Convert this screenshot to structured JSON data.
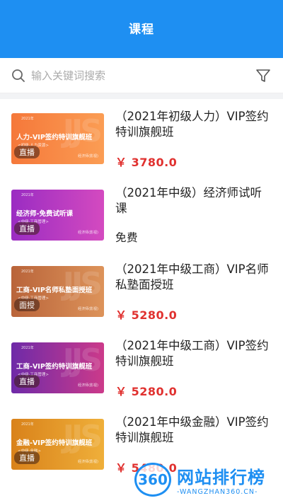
{
  "header": {
    "title": "课程"
  },
  "search": {
    "placeholder": "输入关键词搜索",
    "icon": "search-icon",
    "filter_icon": "filter-icon"
  },
  "courses": [
    {
      "title": "（2021年初级人力）VIP签约特训旗舰班",
      "price": "￥ 3780.0",
      "thumb": {
        "year": "2021年",
        "name": "人力-VIP签约特训旗舰班",
        "sub": "<初级·人力资源>",
        "tag": "直播",
        "brand": "经济师(影视)",
        "jjs": "JJS"
      }
    },
    {
      "title": "（2021年中级）经济师试听课",
      "price": "免费",
      "thumb": {
        "year": "2021年",
        "name": "经济师-免费试听课",
        "sub": "<中级·工商管理>",
        "tag": "直播",
        "brand": "经济师(影视)",
        "jjs": ""
      }
    },
    {
      "title": "（2021年中级工商）VIP名师私塾面授班",
      "price": "￥ 5280.0",
      "thumb": {
        "year": "2021年",
        "name": "工商-VIP名师私塾面授班",
        "sub": "<中级·工商管理>",
        "tag": "面授",
        "brand": "经济师(影视)",
        "jjs": "JJS"
      }
    },
    {
      "title": "（2021年中级工商）VIP签约特训旗舰班",
      "price": "￥ 5280.0",
      "thumb": {
        "year": "2021年",
        "name": "工商-VIP签约特训旗舰班",
        "sub": "<中级·工商管理>",
        "tag": "直播",
        "brand": "经济师(影视)",
        "jjs": "JJS"
      }
    },
    {
      "title": "（2021年中级金融）VIP签约特训旗舰班",
      "price": "￥ 5480.0",
      "thumb": {
        "year": "2021年",
        "name": "金融-VIP签约特训旗舰班",
        "sub": "<中级·金融>",
        "tag": "直播",
        "brand": "经济师(影视)",
        "jjs": "JJS"
      }
    }
  ],
  "watermark": {
    "badge": "360",
    "cn": "网站排行榜",
    "en": "-WANGZHAN360.CN-"
  },
  "colors": {
    "header_bg": "#1e8ff2",
    "price": "#e0312f"
  }
}
